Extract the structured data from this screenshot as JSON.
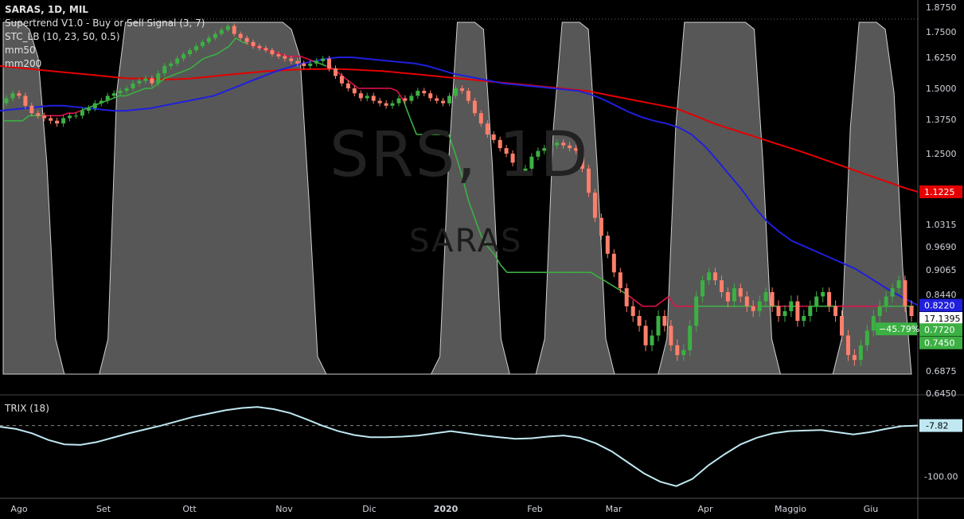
{
  "legend": {
    "title": "SARAS, 1D, MIL",
    "supertrend": "Supertrend V1.0 - Buy or Sell Signal (3, 7)",
    "stc": "STC_LB (10, 23, 50, 0.5)",
    "mm50": "mm50",
    "mm200": "mm200"
  },
  "watermark": {
    "symbol": "SRS, 1D",
    "name": "SARAS"
  },
  "trix_label": "TRIX (18)",
  "chart_data": {
    "type": "candlestick",
    "price_axis": {
      "ticks": [
        "1.8750",
        "1.7500",
        "1.6250",
        "1.5000",
        "1.3750",
        "1.2500",
        "1.1225",
        "1.0315",
        "0.9690",
        "0.9065",
        "0.8440",
        "0.8220",
        "17.1395",
        "0.7720",
        "0.7450",
        "0.6875",
        "0.6450"
      ]
    },
    "price_labels": [
      {
        "text": "1.1225",
        "value": 1.1225,
        "color": "#e50000"
      },
      {
        "text": "0.8220",
        "value": 0.822,
        "color": "#1f1fdd"
      },
      {
        "text": "17.1395",
        "value": 0.81,
        "color": "#ffffff"
      },
      {
        "text": "0.7720",
        "value": 0.772,
        "color": "#3cb043"
      },
      {
        "text": "0.7450",
        "value": 0.745,
        "color": "#3cb043"
      }
    ],
    "badge": {
      "text": "−45.79%",
      "value": 0.772,
      "color": "#3cb043"
    },
    "trix_axis": {
      "ticks": [
        "-7.82",
        "-100.00"
      ]
    },
    "x_axis": [
      "Ago",
      "Set",
      "Ott",
      "Nov",
      "Dic",
      "2020",
      "Feb",
      "Mar",
      "Apr",
      "Maggio",
      "Giu"
    ],
    "colors": {
      "up": "#3cb043",
      "down": "#ff7f6b",
      "mm50": "#1f1fdd",
      "mm200": "#e50000",
      "supertrend_up": "#3cb043",
      "supertrend_down": "#e0104a",
      "stc": "#e8e8e8",
      "trix": "#bfe8f2"
    },
    "mm200": [
      1.59,
      1.585,
      1.58,
      1.575,
      1.57,
      1.565,
      1.56,
      1.555,
      1.55,
      1.545,
      1.54,
      1.54,
      1.538,
      1.536,
      1.537,
      1.54,
      1.545,
      1.55,
      1.555,
      1.56,
      1.565,
      1.57,
      1.572,
      1.575,
      1.577,
      1.578,
      1.578,
      1.577,
      1.575,
      1.572,
      1.57,
      1.565,
      1.56,
      1.555,
      1.55,
      1.545,
      1.54,
      1.535,
      1.53,
      1.525,
      1.52,
      1.515,
      1.51,
      1.505,
      1.5,
      1.495,
      1.49,
      1.48,
      1.47,
      1.46,
      1.45,
      1.44,
      1.43,
      1.42,
      1.4,
      1.38,
      1.36,
      1.345,
      1.33,
      1.315,
      1.3,
      1.285,
      1.27,
      1.255,
      1.24,
      1.225,
      1.21,
      1.195,
      1.18,
      1.165,
      1.15,
      1.135,
      1.1225
    ],
    "mm50": [
      1.41,
      1.415,
      1.42,
      1.425,
      1.43,
      1.43,
      1.425,
      1.42,
      1.415,
      1.41,
      1.41,
      1.415,
      1.42,
      1.43,
      1.44,
      1.45,
      1.46,
      1.47,
      1.49,
      1.51,
      1.53,
      1.55,
      1.57,
      1.585,
      1.6,
      1.61,
      1.62,
      1.625,
      1.625,
      1.62,
      1.615,
      1.61,
      1.605,
      1.6,
      1.59,
      1.575,
      1.56,
      1.55,
      1.54,
      1.53,
      1.52,
      1.515,
      1.51,
      1.505,
      1.5,
      1.495,
      1.49,
      1.475,
      1.455,
      1.43,
      1.405,
      1.385,
      1.37,
      1.36,
      1.345,
      1.32,
      1.28,
      1.23,
      1.18,
      1.13,
      1.08,
      1.04,
      1.01,
      0.985,
      0.97,
      0.955,
      0.94,
      0.925,
      0.91,
      0.89,
      0.87,
      0.85,
      0.835,
      0.822
    ],
    "candles_open": [
      1.44,
      1.46,
      1.48,
      1.47,
      1.43,
      1.4,
      1.39,
      1.38,
      1.37,
      1.36,
      1.38,
      1.39,
      1.39,
      1.41,
      1.42,
      1.44,
      1.45,
      1.47,
      1.48,
      1.49,
      1.5,
      1.52,
      1.53,
      1.54,
      1.52,
      1.56,
      1.59,
      1.6,
      1.62,
      1.64,
      1.66,
      1.68,
      1.7,
      1.72,
      1.74,
      1.76,
      1.78,
      1.74,
      1.72,
      1.7,
      1.68,
      1.67,
      1.66,
      1.64,
      1.63,
      1.62,
      1.61,
      1.6,
      1.59,
      1.6,
      1.61,
      1.62,
      1.58,
      1.55,
      1.52,
      1.5,
      1.48,
      1.46,
      1.47,
      1.45,
      1.44,
      1.43,
      1.44,
      1.46,
      1.45,
      1.47,
      1.49,
      1.48,
      1.46,
      1.45,
      1.44,
      1.47,
      1.5,
      1.49,
      1.45,
      1.4,
      1.36,
      1.32,
      1.3,
      1.27,
      1.25,
      1.22,
      1.19,
      1.2,
      1.24,
      1.26,
      1.27,
      1.28,
      1.29,
      1.28,
      1.27,
      1.26,
      1.2,
      1.12,
      1.05,
      1,
      0.95,
      0.9,
      0.86,
      0.82,
      0.8,
      0.78,
      0.74,
      0.76,
      0.8,
      0.78,
      0.74,
      0.72,
      0.73,
      0.78,
      0.84,
      0.88,
      0.9,
      0.88,
      0.85,
      0.83,
      0.86,
      0.84,
      0.82,
      0.81,
      0.83,
      0.85,
      0.82,
      0.8,
      0.81,
      0.83,
      0.79,
      0.8,
      0.82,
      0.84,
      0.85,
      0.82,
      0.8,
      0.76,
      0.72,
      0.71,
      0.74,
      0.77,
      0.8,
      0.82,
      0.84,
      0.86,
      0.88,
      0.82
    ],
    "candles_close": [
      1.46,
      1.48,
      1.47,
      1.43,
      1.4,
      1.39,
      1.38,
      1.37,
      1.36,
      1.38,
      1.39,
      1.39,
      1.41,
      1.42,
      1.44,
      1.45,
      1.47,
      1.48,
      1.49,
      1.5,
      1.52,
      1.53,
      1.54,
      1.52,
      1.56,
      1.59,
      1.6,
      1.62,
      1.64,
      1.66,
      1.68,
      1.7,
      1.72,
      1.74,
      1.76,
      1.78,
      1.74,
      1.72,
      1.7,
      1.68,
      1.67,
      1.66,
      1.64,
      1.63,
      1.62,
      1.61,
      1.6,
      1.59,
      1.6,
      1.61,
      1.62,
      1.58,
      1.55,
      1.52,
      1.5,
      1.48,
      1.46,
      1.47,
      1.45,
      1.44,
      1.43,
      1.44,
      1.46,
      1.45,
      1.47,
      1.49,
      1.48,
      1.46,
      1.45,
      1.44,
      1.47,
      1.5,
      1.49,
      1.45,
      1.4,
      1.36,
      1.32,
      1.3,
      1.27,
      1.25,
      1.22,
      1.19,
      1.2,
      1.24,
      1.26,
      1.27,
      1.28,
      1.29,
      1.28,
      1.27,
      1.26,
      1.2,
      1.12,
      1.05,
      1,
      0.95,
      0.9,
      0.86,
      0.82,
      0.8,
      0.78,
      0.74,
      0.76,
      0.8,
      0.78,
      0.74,
      0.72,
      0.73,
      0.78,
      0.84,
      0.88,
      0.9,
      0.88,
      0.85,
      0.83,
      0.86,
      0.84,
      0.82,
      0.81,
      0.83,
      0.85,
      0.82,
      0.8,
      0.81,
      0.83,
      0.79,
      0.8,
      0.82,
      0.84,
      0.85,
      0.82,
      0.8,
      0.76,
      0.72,
      0.71,
      0.74,
      0.77,
      0.8,
      0.82,
      0.84,
      0.86,
      0.88,
      0.82,
      0.8
    ],
    "supertrend": [
      1.37,
      1.37,
      1.37,
      1.37,
      1.39,
      1.39,
      1.39,
      1.39,
      1.39,
      1.39,
      1.4,
      1.4,
      1.41,
      1.42,
      1.43,
      1.44,
      1.45,
      1.46,
      1.47,
      1.47,
      1.48,
      1.49,
      1.5,
      1.5,
      1.52,
      1.54,
      1.55,
      1.56,
      1.57,
      1.58,
      1.6,
      1.62,
      1.63,
      1.64,
      1.66,
      1.68,
      1.72,
      1.7,
      1.69,
      1.68,
      1.67,
      1.66,
      1.65,
      1.64,
      1.63,
      1.63,
      1.63,
      1.62,
      1.61,
      1.6,
      1.59,
      1.58,
      1.56,
      1.54,
      1.52,
      1.5,
      1.5,
      1.5,
      1.5,
      1.5,
      1.5,
      1.49,
      1.45,
      1.38,
      1.32,
      1.32,
      1.32,
      1.32,
      1.32,
      1.32,
      1.25,
      1.18,
      1.1,
      1.05,
      1,
      0.97,
      0.95,
      0.92,
      0.9,
      0.9,
      0.9,
      0.9,
      0.9,
      0.9,
      0.9,
      0.9,
      0.9,
      0.9,
      0.9,
      0.9,
      0.9,
      0.9,
      0.89,
      0.88,
      0.87,
      0.86,
      0.85,
      0.84,
      0.83,
      0.82,
      0.82,
      0.82,
      0.83,
      0.84,
      0.82,
      0.82,
      0.82,
      0.82,
      0.82,
      0.82,
      0.82,
      0.82,
      0.82,
      0.82,
      0.82,
      0.82,
      0.82,
      0.82,
      0.82,
      0.82,
      0.82,
      0.82,
      0.82,
      0.82,
      0.82,
      0.82,
      0.82,
      0.82,
      0.82,
      0.82,
      0.82,
      0.82,
      0.82,
      0.82,
      0.82,
      0.82,
      0.82,
      0.82,
      0.82,
      0.82,
      0.82,
      0.82
    ],
    "stc": [
      1,
      1,
      1,
      0.98,
      0.9,
      0.6,
      0.1,
      0,
      0,
      0,
      0,
      0,
      0.1,
      0.8,
      1,
      1,
      1,
      1,
      1,
      1,
      1,
      1,
      1,
      1,
      1,
      1,
      1,
      1,
      1,
      1,
      1,
      1,
      1,
      0.98,
      0.9,
      0.5,
      0.05,
      0,
      0,
      0,
      0,
      0,
      0,
      0,
      0,
      0,
      0,
      0,
      0,
      0,
      0.05,
      0.6,
      1,
      1,
      1,
      0.98,
      0.6,
      0.1,
      0,
      0,
      0,
      0,
      0.1,
      0.7,
      1,
      1,
      1,
      0.98,
      0.6,
      0.1,
      0,
      0,
      0,
      0,
      0,
      0,
      0.1,
      0.7,
      1,
      1,
      1,
      1,
      1,
      1,
      1,
      1,
      0.98,
      0.6,
      0.1,
      0,
      0,
      0,
      0,
      0,
      0,
      0,
      0.1,
      0.7,
      1,
      1,
      1,
      0.98,
      0.8,
      0.3,
      0.0
    ],
    "trix": [
      -10,
      -14,
      -22,
      -34,
      -42,
      -43,
      -38,
      -30,
      -22,
      -15,
      -8,
      0,
      8,
      14,
      20,
      24,
      26,
      22,
      15,
      4,
      -8,
      -18,
      -25,
      -29,
      -29,
      -28,
      -26,
      -22,
      -18,
      -22,
      -26,
      -29,
      -32,
      -31,
      -28,
      -26,
      -30,
      -40,
      -55,
      -75,
      -95,
      -110,
      -118,
      -105,
      -80,
      -60,
      -42,
      -30,
      -22,
      -18,
      -17,
      -16,
      -20,
      -24,
      -20,
      -14,
      -9,
      -7.82
    ]
  }
}
